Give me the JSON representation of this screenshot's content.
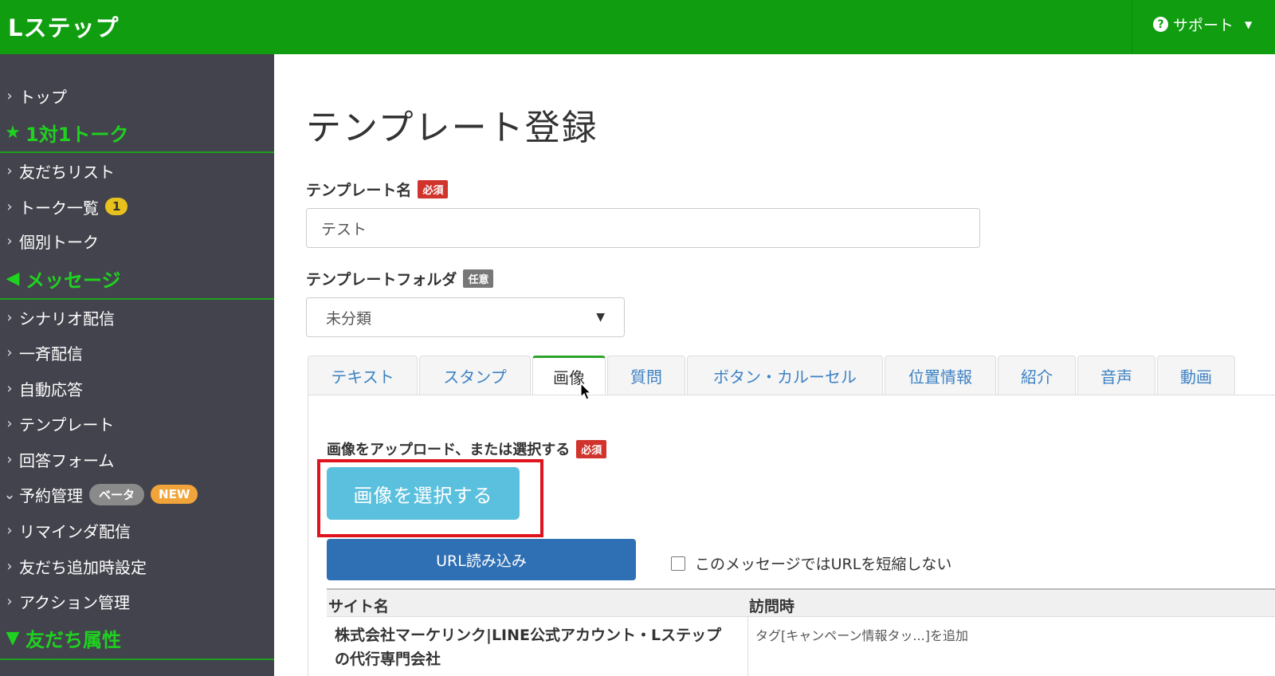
{
  "header": {
    "logo": "Lステップ",
    "support_label": "サポート"
  },
  "sidebar": {
    "items": [
      {
        "type": "link",
        "label": "トップ"
      },
      {
        "type": "section",
        "icon": "star-icon",
        "label": "1対1トーク"
      },
      {
        "type": "link",
        "label": "友だちリスト"
      },
      {
        "type": "link",
        "label": "トーク一覧",
        "badge": "1"
      },
      {
        "type": "link",
        "label": "個別トーク"
      },
      {
        "type": "section",
        "icon": "megaphone-icon",
        "label": "メッセージ"
      },
      {
        "type": "link",
        "label": "シナリオ配信"
      },
      {
        "type": "link",
        "label": "一斉配信"
      },
      {
        "type": "link",
        "label": "自動応答"
      },
      {
        "type": "link",
        "label": "テンプレート"
      },
      {
        "type": "link",
        "label": "回答フォーム"
      },
      {
        "type": "link",
        "label": "予約管理",
        "badges": [
          "ベータ",
          "NEW"
        ],
        "expanded": true
      },
      {
        "type": "link",
        "label": "リマインダ配信"
      },
      {
        "type": "link",
        "label": "友だち追加時設定"
      },
      {
        "type": "link",
        "label": "アクション管理"
      },
      {
        "type": "section",
        "icon": "filter-icon",
        "label": "友だち属性"
      }
    ]
  },
  "main": {
    "title": "テンプレート登録",
    "name_label": "テンプレート名",
    "required": "必須",
    "optional": "任意",
    "name_value": "テスト",
    "folder_label": "テンプレートフォルダ",
    "folder_value": "未分類",
    "tabs": [
      {
        "label": "テキスト",
        "active": false
      },
      {
        "label": "スタンプ",
        "active": false
      },
      {
        "label": "画像",
        "active": true
      },
      {
        "label": "質問",
        "active": false
      },
      {
        "label": "ボタン・カルーセル",
        "active": false
      },
      {
        "label": "位置情報",
        "active": false
      },
      {
        "label": "紹介",
        "active": false
      },
      {
        "label": "音声",
        "active": false
      },
      {
        "label": "動画",
        "active": false
      }
    ],
    "upload_label": "画像をアップロード、または選択する",
    "select_image_button": "画像を選択する",
    "url_button": "URL読み込み",
    "no_shorten_label": "このメッセージではURLを短縮しない",
    "table": {
      "headers": [
        "サイト名",
        "訪問時"
      ],
      "rows": [
        {
          "site": "株式会社マーケリンク|LINE公式アカウント・Lステップの代行専門会社",
          "visit": "タグ[キャンペーン情報タッ...]を追加"
        }
      ]
    }
  },
  "colors": {
    "header_green": "#109e10",
    "sidebar_bg": "#43434d",
    "section_green": "#1fd21f",
    "highlight_red": "#e0141e"
  }
}
